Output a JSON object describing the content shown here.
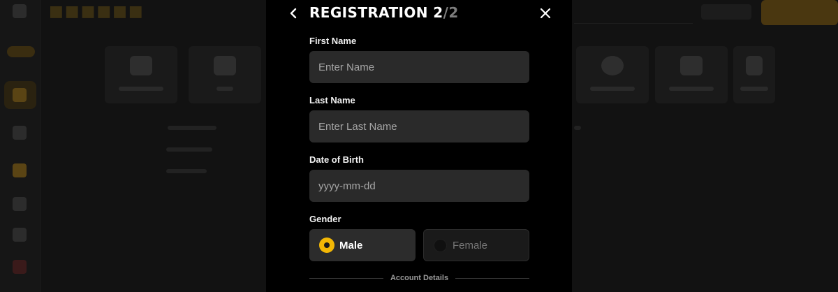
{
  "modal": {
    "title": "REGISTRATION",
    "step_current": "2",
    "step_separator": "/",
    "step_total": "2"
  },
  "form": {
    "first_name": {
      "label": "First Name",
      "placeholder": "Enter Name",
      "value": ""
    },
    "last_name": {
      "label": "Last Name",
      "placeholder": "Enter Last Name",
      "value": ""
    },
    "dob": {
      "label": "Date of Birth",
      "placeholder": "yyyy-mm-dd",
      "value": ""
    },
    "gender": {
      "label": "Gender",
      "selected": "Male",
      "options": [
        {
          "label": "Male"
        },
        {
          "label": "Female"
        }
      ]
    },
    "section_account": "Account Details"
  },
  "icons": {
    "back": "chevron-left-icon",
    "close": "close-icon"
  },
  "colors": {
    "accent": "#f2b705",
    "modal_bg": "#000000",
    "input_bg": "#2a2a2a",
    "backdrop": "#121212"
  }
}
